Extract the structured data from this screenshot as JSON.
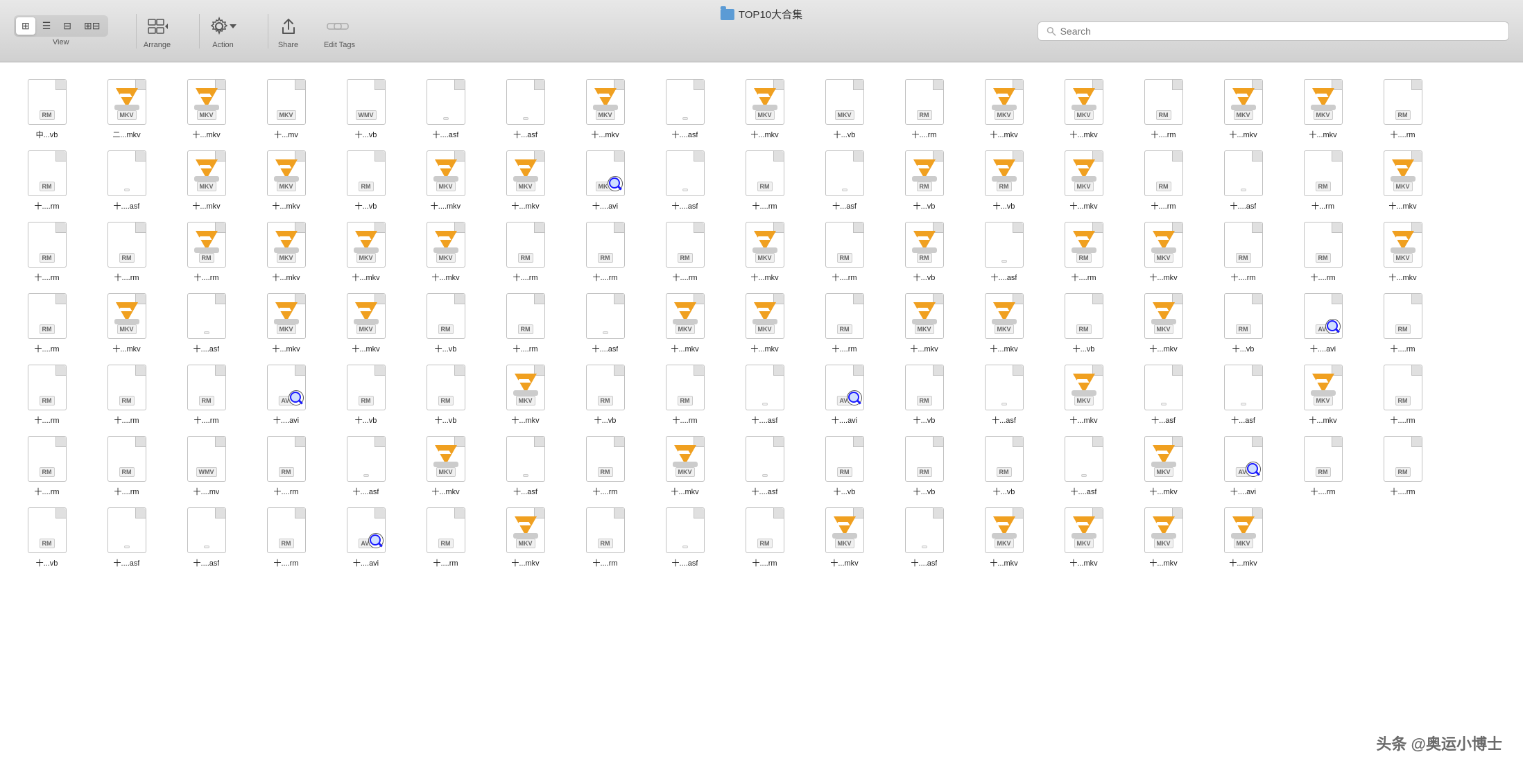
{
  "toolbar": {
    "title": "TOP10大合集",
    "view_label": "View",
    "arrange_label": "Arrange",
    "action_label": "Action",
    "share_label": "Share",
    "edit_tags_label": "Edit Tags",
    "search_placeholder": "Search",
    "search_label": "Search"
  },
  "files": [
    {
      "label": "中...vb",
      "type": "doc",
      "badge": "RM"
    },
    {
      "label": "二...mkv",
      "type": "vlc",
      "badge": "MKV"
    },
    {
      "label": "十...mkv",
      "type": "vlc",
      "badge": "MKV"
    },
    {
      "label": "十...mv",
      "type": "doc",
      "badge": "MKV"
    },
    {
      "label": "十...vb",
      "type": "doc",
      "badge": "WMV"
    },
    {
      "label": "十....asf",
      "type": "doc",
      "badge": ""
    },
    {
      "label": "十...asf",
      "type": "doc",
      "badge": ""
    },
    {
      "label": "十...mkv",
      "type": "vlc",
      "badge": "MKV"
    },
    {
      "label": "十....asf",
      "type": "doc",
      "badge": ""
    },
    {
      "label": "十...mkv",
      "type": "vlc",
      "badge": "MKV"
    },
    {
      "label": "十...vb",
      "type": "doc",
      "badge": "MKV"
    },
    {
      "label": "十....rm",
      "type": "doc",
      "badge": "RM"
    },
    {
      "label": "十...mkv",
      "type": "vlc",
      "badge": "MKV"
    },
    {
      "label": "十...mkv",
      "type": "vlc",
      "badge": "MKV"
    },
    {
      "label": "十....rm",
      "type": "doc",
      "badge": "RM"
    },
    {
      "label": "十...mkv",
      "type": "vlc",
      "badge": "MKV"
    },
    {
      "label": "十...mkv",
      "type": "vlc",
      "badge": "MKV"
    },
    {
      "label": "十....rm",
      "type": "doc",
      "badge": "RM"
    },
    {
      "label": "十....rm",
      "type": "doc",
      "badge": "RM"
    },
    {
      "label": "十....asf",
      "type": "doc",
      "badge": ""
    },
    {
      "label": "十...mkv",
      "type": "vlc",
      "badge": "MKV"
    },
    {
      "label": "十...mkv",
      "type": "vlc",
      "badge": "MKV"
    },
    {
      "label": "十...vb",
      "type": "doc",
      "badge": "RM"
    },
    {
      "label": "十....mkv",
      "type": "vlc",
      "badge": "MKV"
    },
    {
      "label": "十...mkv",
      "type": "vlc",
      "badge": "MKV"
    },
    {
      "label": "十....avi",
      "type": "avi",
      "badge": "MKV"
    },
    {
      "label": "十....asf",
      "type": "doc",
      "badge": ""
    },
    {
      "label": "十....rm",
      "type": "doc",
      "badge": "RM"
    },
    {
      "label": "十...asf",
      "type": "doc",
      "badge": ""
    },
    {
      "label": "十...vb",
      "type": "vlc",
      "badge": "RM"
    },
    {
      "label": "十...vb",
      "type": "vlc",
      "badge": "RM"
    },
    {
      "label": "十...mkv",
      "type": "vlc",
      "badge": "MKV"
    },
    {
      "label": "十....rm",
      "type": "doc",
      "badge": "RM"
    },
    {
      "label": "十....asf",
      "type": "doc",
      "badge": ""
    },
    {
      "label": "十...rm",
      "type": "doc",
      "badge": "RM"
    },
    {
      "label": "十...mkv",
      "type": "vlc",
      "badge": "MKV"
    },
    {
      "label": "十....rm",
      "type": "doc",
      "badge": "RM"
    },
    {
      "label": "十....rm",
      "type": "doc",
      "badge": "RM"
    },
    {
      "label": "十....rm",
      "type": "vlc",
      "badge": "RM"
    },
    {
      "label": "十...mkv",
      "type": "vlc",
      "badge": "MKV"
    },
    {
      "label": "十...mkv",
      "type": "vlc",
      "badge": "MKV"
    },
    {
      "label": "十...mkv",
      "type": "vlc",
      "badge": "MKV"
    },
    {
      "label": "十....rm",
      "type": "doc",
      "badge": "RM"
    },
    {
      "label": "十....rm",
      "type": "doc",
      "badge": "RM"
    },
    {
      "label": "十....rm",
      "type": "doc",
      "badge": "RM"
    },
    {
      "label": "十...mkv",
      "type": "vlc",
      "badge": "MKV"
    },
    {
      "label": "十....rm",
      "type": "doc",
      "badge": "RM"
    },
    {
      "label": "十...vb",
      "type": "vlc",
      "badge": "RM"
    },
    {
      "label": "十....asf",
      "type": "doc",
      "badge": ""
    },
    {
      "label": "十....rm",
      "type": "vlc",
      "badge": "RM"
    },
    {
      "label": "十...mkv",
      "type": "vlc",
      "badge": "MKV"
    },
    {
      "label": "十....rm",
      "type": "doc",
      "badge": "RM"
    },
    {
      "label": "十....rm",
      "type": "doc",
      "badge": "RM"
    },
    {
      "label": "十...mkv",
      "type": "vlc",
      "badge": "MKV"
    },
    {
      "label": "十....rm",
      "type": "doc",
      "badge": "RM"
    },
    {
      "label": "十...mkv",
      "type": "vlc",
      "badge": "MKV"
    },
    {
      "label": "十....asf",
      "type": "doc",
      "badge": ""
    },
    {
      "label": "十...mkv",
      "type": "vlc",
      "badge": "MKV"
    },
    {
      "label": "十...mkv",
      "type": "vlc",
      "badge": "MKV"
    },
    {
      "label": "十...vb",
      "type": "doc",
      "badge": "RM"
    },
    {
      "label": "十....rm",
      "type": "doc",
      "badge": "RM"
    },
    {
      "label": "十....asf",
      "type": "doc",
      "badge": ""
    },
    {
      "label": "十...mkv",
      "type": "vlc",
      "badge": "MKV"
    },
    {
      "label": "十...mkv",
      "type": "vlc",
      "badge": "MKV"
    },
    {
      "label": "十....rm",
      "type": "doc",
      "badge": "RM"
    },
    {
      "label": "十...mkv",
      "type": "vlc",
      "badge": "MKV"
    },
    {
      "label": "十...mkv",
      "type": "vlc",
      "badge": "MKV"
    },
    {
      "label": "十...vb",
      "type": "doc",
      "badge": "RM"
    },
    {
      "label": "十...mkv",
      "type": "vlc",
      "badge": "MKV"
    },
    {
      "label": "十...vb",
      "type": "doc",
      "badge": "RM"
    },
    {
      "label": "十....avi",
      "type": "avi",
      "badge": "AVI"
    },
    {
      "label": "十....rm",
      "type": "doc",
      "badge": "RM"
    },
    {
      "label": "十....rm",
      "type": "doc",
      "badge": "RM"
    },
    {
      "label": "十....rm",
      "type": "doc",
      "badge": "RM"
    },
    {
      "label": "十....rm",
      "type": "doc",
      "badge": "RM"
    },
    {
      "label": "十....avi",
      "type": "avi",
      "badge": "AVI"
    },
    {
      "label": "十...vb",
      "type": "doc",
      "badge": "RM"
    },
    {
      "label": "十...vb",
      "type": "doc",
      "badge": "RM"
    },
    {
      "label": "十...mkv",
      "type": "vlc",
      "badge": "MKV"
    },
    {
      "label": "十...vb",
      "type": "doc",
      "badge": "RM"
    },
    {
      "label": "十....rm",
      "type": "doc",
      "badge": "RM"
    },
    {
      "label": "十....asf",
      "type": "doc",
      "badge": ""
    },
    {
      "label": "十....avi",
      "type": "avi",
      "badge": "AVI"
    },
    {
      "label": "十...vb",
      "type": "doc",
      "badge": "RM"
    },
    {
      "label": "十...asf",
      "type": "doc",
      "badge": ""
    },
    {
      "label": "十...mkv",
      "type": "vlc",
      "badge": "MKV"
    },
    {
      "label": "十...asf",
      "type": "doc",
      "badge": ""
    },
    {
      "label": "十...asf",
      "type": "doc",
      "badge": ""
    },
    {
      "label": "十...mkv",
      "type": "vlc",
      "badge": "MKV"
    },
    {
      "label": "十....rm",
      "type": "doc",
      "badge": "RM"
    },
    {
      "label": "十....rm",
      "type": "doc",
      "badge": "RM"
    },
    {
      "label": "十....rm",
      "type": "doc",
      "badge": "RM"
    },
    {
      "label": "十....mv",
      "type": "doc",
      "badge": "WMV"
    },
    {
      "label": "十....rm",
      "type": "doc",
      "badge": "RM"
    },
    {
      "label": "十....asf",
      "type": "doc",
      "badge": ""
    },
    {
      "label": "十...mkv",
      "type": "vlc",
      "badge": "MKV"
    },
    {
      "label": "十...asf",
      "type": "doc",
      "badge": ""
    },
    {
      "label": "十....rm",
      "type": "doc",
      "badge": "RM"
    },
    {
      "label": "十...mkv",
      "type": "vlc",
      "badge": "MKV"
    },
    {
      "label": "十....asf",
      "type": "doc",
      "badge": ""
    },
    {
      "label": "十...vb",
      "type": "doc",
      "badge": "RM"
    },
    {
      "label": "十...vb",
      "type": "doc",
      "badge": "RM"
    },
    {
      "label": "十...vb",
      "type": "doc",
      "badge": "RM"
    },
    {
      "label": "十....asf",
      "type": "doc",
      "badge": ""
    },
    {
      "label": "十...mkv",
      "type": "vlc",
      "badge": "MKV"
    },
    {
      "label": "十....avi",
      "type": "avi",
      "badge": "AVI"
    },
    {
      "label": "十....rm",
      "type": "doc",
      "badge": "RM"
    },
    {
      "label": "十....rm",
      "type": "doc",
      "badge": "RM"
    },
    {
      "label": "十...vb",
      "type": "doc",
      "badge": "RM"
    },
    {
      "label": "十....asf",
      "type": "doc",
      "badge": ""
    },
    {
      "label": "十....asf",
      "type": "doc",
      "badge": ""
    },
    {
      "label": "十....rm",
      "type": "doc",
      "badge": "RM"
    },
    {
      "label": "十....avi",
      "type": "avi",
      "badge": "AVI"
    },
    {
      "label": "十....rm",
      "type": "doc",
      "badge": "RM"
    },
    {
      "label": "十...mkv",
      "type": "vlc",
      "badge": "MKV"
    },
    {
      "label": "十....rm",
      "type": "doc",
      "badge": "RM"
    },
    {
      "label": "十....asf",
      "type": "doc",
      "badge": ""
    },
    {
      "label": "十....rm",
      "type": "doc",
      "badge": "RM"
    },
    {
      "label": "十...mkv",
      "type": "vlc",
      "badge": "MKV"
    },
    {
      "label": "十....asf",
      "type": "doc",
      "badge": ""
    },
    {
      "label": "十...mkv",
      "type": "vlc",
      "badge": "MKV"
    },
    {
      "label": "十...mkv",
      "type": "vlc",
      "badge": "MKV"
    },
    {
      "label": "十...mkv",
      "type": "vlc",
      "badge": "MKV"
    },
    {
      "label": "十...mkv",
      "type": "vlc",
      "badge": "MKV"
    }
  ],
  "watermark": "头条 @奥运小博士"
}
